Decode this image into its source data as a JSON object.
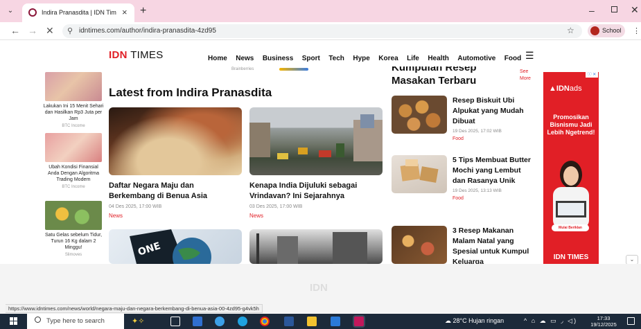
{
  "browser": {
    "tab_title": "Indira Pranasdita | IDN Times | I",
    "tab_close": "×",
    "new_tab": "+",
    "url": "idntimes.com/author/indira-pranasdita-4zd95",
    "profile": "School",
    "status_url": "https://www.idntimes.com/news/world/negara-maju-dan-negara-berkembang-di-benua-asia-00-4zd95-g4vk5h"
  },
  "site": {
    "logo_idn": "IDN",
    "logo_times": "TIMES",
    "nav": [
      "Home",
      "News",
      "Business",
      "Sport",
      "Tech",
      "Hype",
      "Korea",
      "Life",
      "Health",
      "Automotive",
      "Food"
    ]
  },
  "left_rail": [
    {
      "title": "Lakukan Ini 15 Menit Sehari dan Hasilkan Rp3 Juta per Jam",
      "source": "BTC Income"
    },
    {
      "title": "Ubah Kondisi Finansial Anda Dengan Algoritma Trading Modern",
      "source": "BTC Income"
    },
    {
      "title": "Satu Gelas sebelum Tidur, Turun 16 Kg dalam 2 Minggu!",
      "source": "Slimoves"
    }
  ],
  "main": {
    "prev_ad_label": "Brainberries",
    "section_title": "Latest from Indira Pranasdita",
    "articles": [
      {
        "title": "Daftar Negara Maju dan Berkembang di Benua Asia",
        "date": "04 Des 2025, 17:00 WIB",
        "category": "News"
      },
      {
        "title": "Kenapa India Dijuluki sebagai Vrindavan? Ini Sejarahnya",
        "date": "03 Des 2025, 17:00 WIB",
        "category": "News"
      }
    ],
    "poster_text": "ONE"
  },
  "sidebar": {
    "title": "Kumpulan Resep Masakan Terbaru",
    "see_more": "See More",
    "recipes": [
      {
        "title": "Resep Biskuit Ubi Alpukat yang Mudah Dibuat",
        "date": "19 Des 2025, 17:02 WIB",
        "category": "Food"
      },
      {
        "title": "5 Tips Membuat Butter Mochi yang Lembut dan Rasanya Unik",
        "date": "19 Des 2025, 13:13 WIB",
        "category": "Food"
      },
      {
        "title": "3 Resep Makanan Malam Natal yang Spesial untuk Kumpul Keluarga",
        "date": "",
        "category": ""
      }
    ]
  },
  "ad": {
    "logo_bold": "IDN",
    "logo_light": "ads",
    "text": "Promosikan Bisnismu Jadi Lebih Ngetrend!",
    "cta": "Mulai Beriklan",
    "footer": "IDN TIMES"
  },
  "bottom_logo": "IDN",
  "taskbar": {
    "search_placeholder": "Type here to search",
    "weather": "28°C  Hujan ringan",
    "time": "17:33",
    "date": "19/12/2025"
  },
  "colors": {
    "brand_red": "#e11f26",
    "tab_bar": "#f7d6e3",
    "taskbar": "#1c2a3a"
  }
}
